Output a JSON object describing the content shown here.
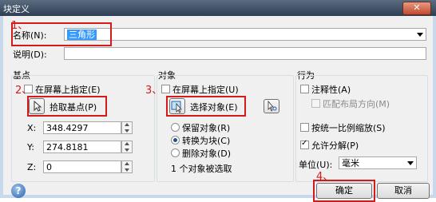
{
  "window": {
    "title": "块定义",
    "close_symbol": "✕"
  },
  "name": {
    "label": "名称(N):",
    "value": "三角形"
  },
  "description": {
    "label": "说明(D):",
    "value": ""
  },
  "base_point": {
    "group_title": "基点",
    "specify_on_screen": "在屏幕上指定(E)",
    "pick_button": "拾取基点(P)",
    "x_label": "X:",
    "x_value": "348.4297",
    "y_label": "Y:",
    "y_value": "274.8181",
    "z_label": "Z:",
    "z_value": "0"
  },
  "objects": {
    "group_title": "对象",
    "specify_on_screen": "在屏幕上指定(U)",
    "select_button": "选择对象(E)",
    "retain": "保留对象(R)",
    "convert": "转换为块(C)",
    "delete": "删除对象(D)",
    "status": "1 个对象被选取"
  },
  "behavior": {
    "group_title": "行为",
    "annotative": "注释性(A)",
    "match_orientation": "匹配布局方向(M)",
    "scale_uniformly": "按统一比例缩放(S)",
    "allow_exploding": "允许分解(P)"
  },
  "units": {
    "label": "单位(U):",
    "value": "毫米"
  },
  "buttons": {
    "ok": "确定",
    "cancel": "取消",
    "help": "?"
  },
  "annotations": {
    "step1": "1、",
    "step2": "2、",
    "step3": "3、",
    "step4": "4、"
  },
  "colors": {
    "annotation_red": "#d61a1a",
    "selection_blue": "#3399ff"
  }
}
